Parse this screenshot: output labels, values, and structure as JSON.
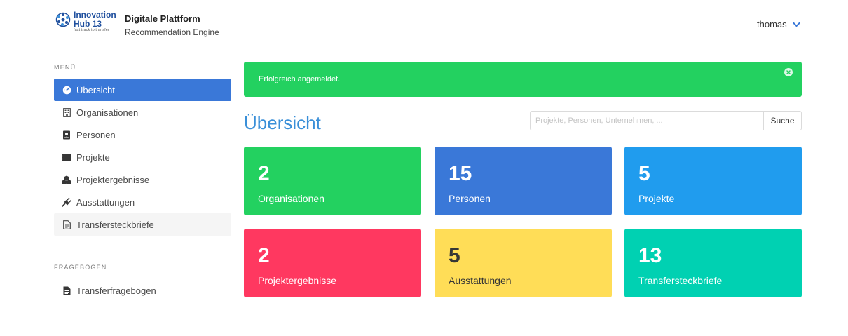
{
  "header": {
    "logo": {
      "line1": "Innovation",
      "line2": "Hub 13",
      "tagline": "fast track to transfer"
    },
    "brand_title": "Digitale Plattform",
    "brand_subtitle": "Recommendation Engine",
    "user": "thomas"
  },
  "sidebar": {
    "menu_label": "MENÜ",
    "items": [
      {
        "label": "Übersicht",
        "icon": "dashboard-icon"
      },
      {
        "label": "Organisationen",
        "icon": "building-icon"
      },
      {
        "label": "Personen",
        "icon": "address-book-icon"
      },
      {
        "label": "Projekte",
        "icon": "list-icon"
      },
      {
        "label": "Projektergebnisse",
        "icon": "cubes-icon"
      },
      {
        "label": "Ausstattungen",
        "icon": "plug-icon"
      },
      {
        "label": "Transfersteckbriefe",
        "icon": "document-icon"
      }
    ],
    "section2_label": "FRAGEBÖGEN",
    "section2_items": [
      {
        "label": "Transferfragebögen",
        "icon": "file-icon"
      }
    ]
  },
  "notice": {
    "text": "Erfolgreich angemeldet."
  },
  "main": {
    "title": "Übersicht",
    "search": {
      "placeholder": "Projekte, Personen, Unternehmen, ...",
      "value": "",
      "button": "Suche"
    },
    "tiles": [
      {
        "number": "2",
        "label": "Organisationen",
        "color": "#23d160"
      },
      {
        "number": "15",
        "label": "Personen",
        "color": "#3a78d8"
      },
      {
        "number": "5",
        "label": "Projekte",
        "color": "#209cee"
      },
      {
        "number": "2",
        "label": "Projektergebnisse",
        "color": "#ff3860"
      },
      {
        "number": "5",
        "label": "Ausstattungen",
        "color": "#ffdd57"
      },
      {
        "number": "13",
        "label": "Transfersteckbriefe",
        "color": "#00d1b2"
      }
    ]
  },
  "colors": {
    "accent": "#3a78d8",
    "title": "#3a8fd8",
    "success": "#23d160"
  }
}
